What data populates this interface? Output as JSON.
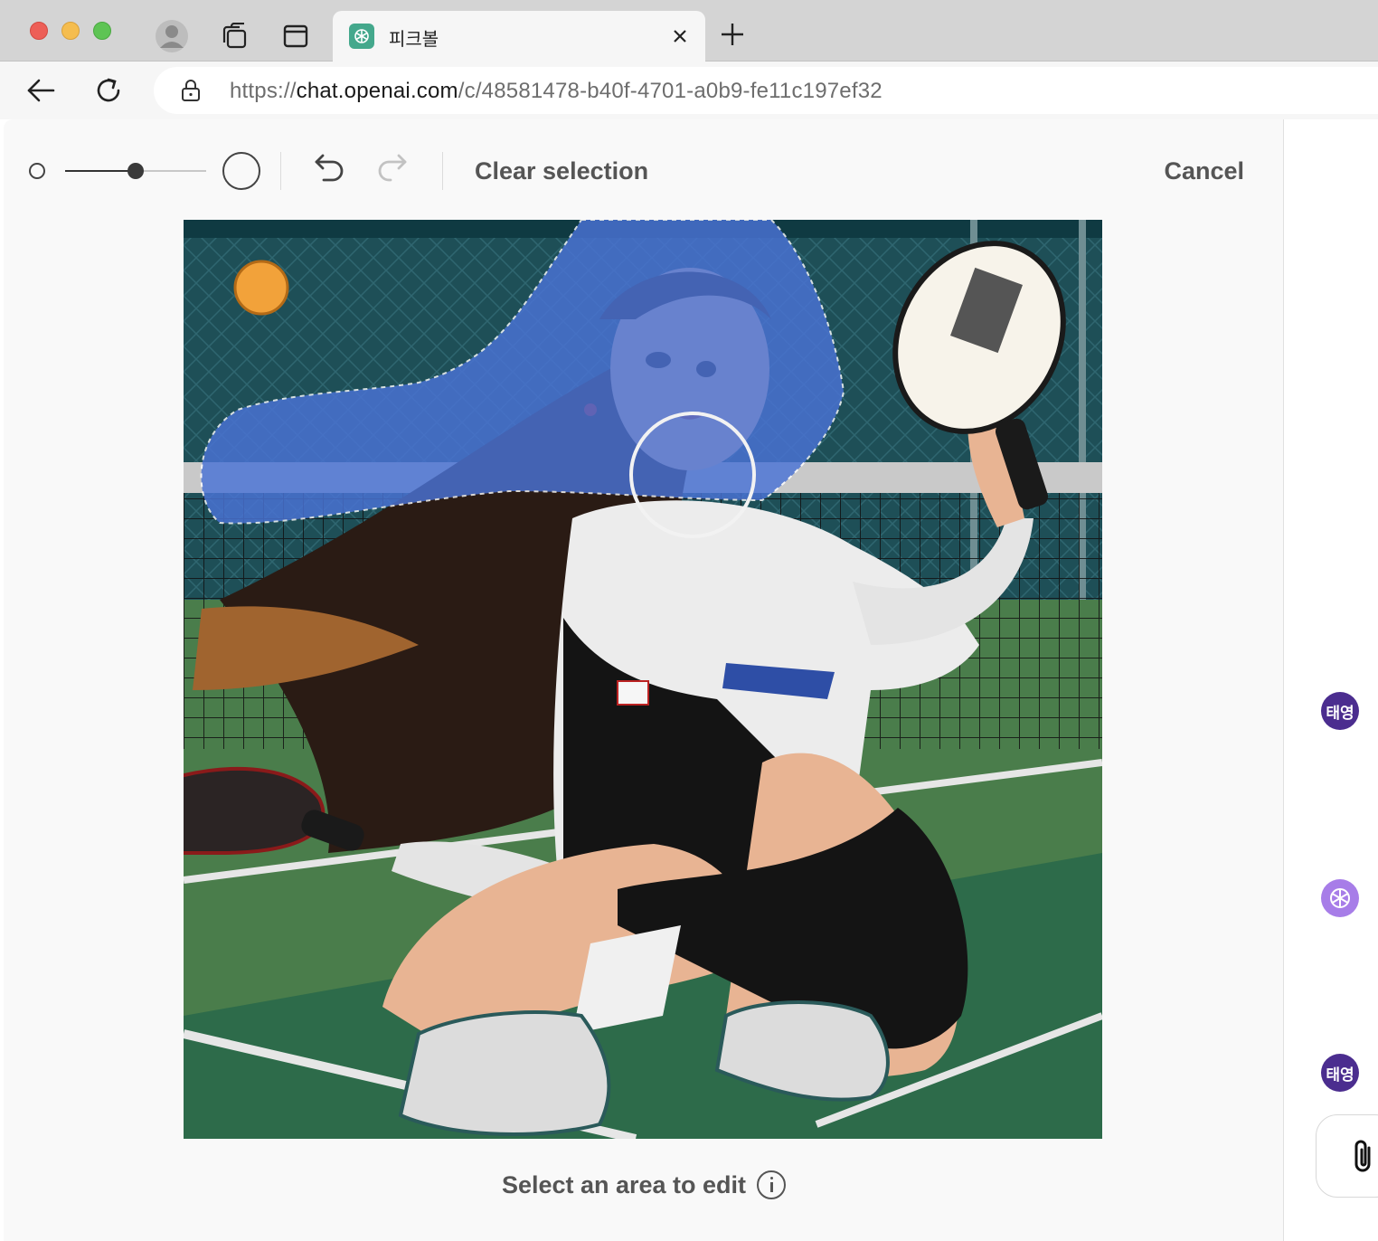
{
  "browser": {
    "tab_title": "피크볼",
    "url_prefix": "https://",
    "url_host": "chat.openai.com",
    "url_path": "/c/48581478-b40f-4701-a0b9-fe11c197ef32"
  },
  "editor": {
    "clear_label": "Clear selection",
    "cancel_label": "Cancel",
    "hint": "Select an area to edit",
    "brush_size_fraction": 0.5,
    "icons": [
      "brush-small-icon",
      "brush-large-icon",
      "undo-icon",
      "redo-icon",
      "info-icon"
    ]
  },
  "sidebar": {
    "user_initials": "태영",
    "attach_icon": "paperclip-icon"
  },
  "colors": {
    "selection": "#4a73d6",
    "accent_user": "#4b2d8f",
    "accent_gpt": "#a77de8"
  }
}
